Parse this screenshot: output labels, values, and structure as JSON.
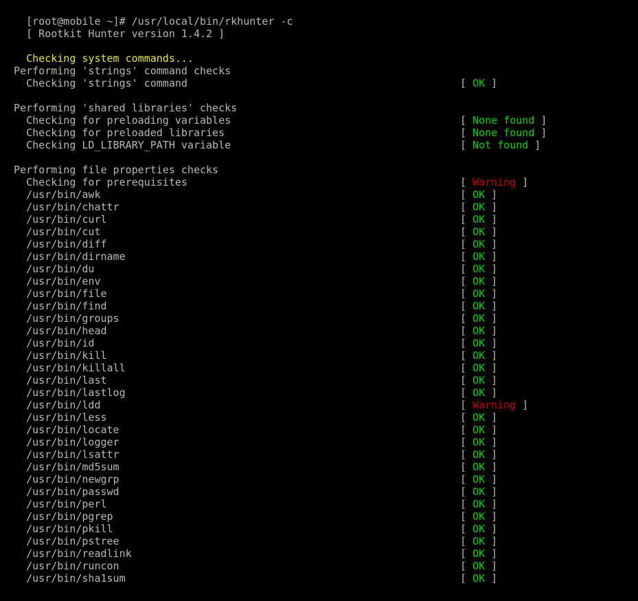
{
  "terminal": {
    "colors": {
      "background": "#000000",
      "foreground": "#c8c8c8",
      "ok_green": "#00d700",
      "warning_red": "#cc0000",
      "section_yellow": "#e9e92b"
    },
    "prompt_line": "[root@mobile ~]# /usr/local/bin/rkhunter -c",
    "version_line": "[ Rootkit Hunter version 1.4.2 ]",
    "section_header": "Checking system commands...",
    "groups": [
      {
        "heading": "  Performing 'strings' command checks",
        "rows": [
          {
            "label": "    Checking 'strings' command",
            "status": "OK",
            "status_class": "c-green"
          }
        ]
      },
      {
        "heading": "  Performing 'shared libraries' checks",
        "rows": [
          {
            "label": "    Checking for preloading variables",
            "status": "None found",
            "status_class": "c-green"
          },
          {
            "label": "    Checking for preloaded libraries",
            "status": "None found",
            "status_class": "c-green"
          },
          {
            "label": "    Checking LD_LIBRARY_PATH variable",
            "status": "Not found",
            "status_class": "c-green"
          }
        ]
      },
      {
        "heading": "  Performing file properties checks",
        "rows": [
          {
            "label": "    Checking for prerequisites",
            "status": "Warning",
            "status_class": "c-red"
          },
          {
            "label": "    /usr/bin/awk",
            "status": "OK",
            "status_class": "c-green"
          },
          {
            "label": "    /usr/bin/chattr",
            "status": "OK",
            "status_class": "c-green"
          },
          {
            "label": "    /usr/bin/curl",
            "status": "OK",
            "status_class": "c-green"
          },
          {
            "label": "    /usr/bin/cut",
            "status": "OK",
            "status_class": "c-green"
          },
          {
            "label": "    /usr/bin/diff",
            "status": "OK",
            "status_class": "c-green"
          },
          {
            "label": "    /usr/bin/dirname",
            "status": "OK",
            "status_class": "c-green"
          },
          {
            "label": "    /usr/bin/du",
            "status": "OK",
            "status_class": "c-green"
          },
          {
            "label": "    /usr/bin/env",
            "status": "OK",
            "status_class": "c-green"
          },
          {
            "label": "    /usr/bin/file",
            "status": "OK",
            "status_class": "c-green"
          },
          {
            "label": "    /usr/bin/find",
            "status": "OK",
            "status_class": "c-green"
          },
          {
            "label": "    /usr/bin/groups",
            "status": "OK",
            "status_class": "c-green"
          },
          {
            "label": "    /usr/bin/head",
            "status": "OK",
            "status_class": "c-green"
          },
          {
            "label": "    /usr/bin/id",
            "status": "OK",
            "status_class": "c-green"
          },
          {
            "label": "    /usr/bin/kill",
            "status": "OK",
            "status_class": "c-green"
          },
          {
            "label": "    /usr/bin/killall",
            "status": "OK",
            "status_class": "c-green"
          },
          {
            "label": "    /usr/bin/last",
            "status": "OK",
            "status_class": "c-green"
          },
          {
            "label": "    /usr/bin/lastlog",
            "status": "OK",
            "status_class": "c-green"
          },
          {
            "label": "    /usr/bin/ldd",
            "status": "Warning",
            "status_class": "c-red"
          },
          {
            "label": "    /usr/bin/less",
            "status": "OK",
            "status_class": "c-green"
          },
          {
            "label": "    /usr/bin/locate",
            "status": "OK",
            "status_class": "c-green"
          },
          {
            "label": "    /usr/bin/logger",
            "status": "OK",
            "status_class": "c-green"
          },
          {
            "label": "    /usr/bin/lsattr",
            "status": "OK",
            "status_class": "c-green"
          },
          {
            "label": "    /usr/bin/md5sum",
            "status": "OK",
            "status_class": "c-green"
          },
          {
            "label": "    /usr/bin/newgrp",
            "status": "OK",
            "status_class": "c-green"
          },
          {
            "label": "    /usr/bin/passwd",
            "status": "OK",
            "status_class": "c-green"
          },
          {
            "label": "    /usr/bin/perl",
            "status": "OK",
            "status_class": "c-green"
          },
          {
            "label": "    /usr/bin/pgrep",
            "status": "OK",
            "status_class": "c-green"
          },
          {
            "label": "    /usr/bin/pkill",
            "status": "OK",
            "status_class": "c-green"
          },
          {
            "label": "    /usr/bin/pstree",
            "status": "OK",
            "status_class": "c-green"
          },
          {
            "label": "    /usr/bin/readlink",
            "status": "OK",
            "status_class": "c-green"
          },
          {
            "label": "    /usr/bin/runcon",
            "status": "OK",
            "status_class": "c-green"
          },
          {
            "label": "    /usr/bin/sha1sum",
            "status": "OK",
            "status_class": "c-green"
          }
        ]
      }
    ],
    "bracket_open": "[ ",
    "bracket_close": " ]"
  }
}
